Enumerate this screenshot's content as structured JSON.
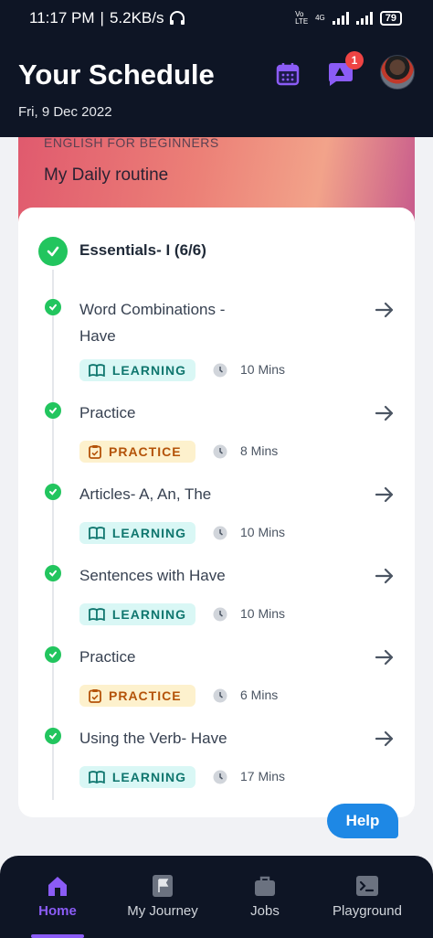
{
  "status_bar": {
    "time": "11:17 PM",
    "speed": "5.2KB/s",
    "network": "4G",
    "volte": "Vo LTE",
    "battery": "79"
  },
  "header": {
    "title": "Your Schedule",
    "date": "Fri, 9 Dec 2022",
    "notification_count": "1"
  },
  "banner": {
    "kicker": "ENGLISH FOR BEGINNERS",
    "title": "My Daily routine"
  },
  "section": {
    "title": "Essentials- I (6/6)"
  },
  "items": [
    {
      "title": "Word Combinations - Have",
      "tag": "LEARNING",
      "duration": "10 Mins"
    },
    {
      "title": "Practice",
      "tag": "PRACTICE",
      "duration": "8 Mins"
    },
    {
      "title": "Articles- A, An, The",
      "tag": "LEARNING",
      "duration": "10 Mins"
    },
    {
      "title": "Sentences with Have",
      "tag": "LEARNING",
      "duration": "10 Mins"
    },
    {
      "title": "Practice",
      "tag": "PRACTICE",
      "duration": "6 Mins"
    },
    {
      "title": "Using the Verb- Have",
      "tag": "LEARNING",
      "duration": "17 Mins"
    }
  ],
  "help": {
    "label": "Help"
  },
  "nav": [
    {
      "label": "Home",
      "icon": "home-icon",
      "active": true
    },
    {
      "label": "My Journey",
      "icon": "flag-icon",
      "active": false
    },
    {
      "label": "Jobs",
      "icon": "briefcase-icon",
      "active": false
    },
    {
      "label": "Playground",
      "icon": "terminal-icon",
      "active": false
    }
  ],
  "colors": {
    "header_bg": "#0e1525",
    "accent_purple": "#8b5cf6",
    "success_green": "#22c55e",
    "learning_bg": "#d9f7f5",
    "practice_bg": "#fdf1cd",
    "help_blue": "#1e88e5"
  }
}
